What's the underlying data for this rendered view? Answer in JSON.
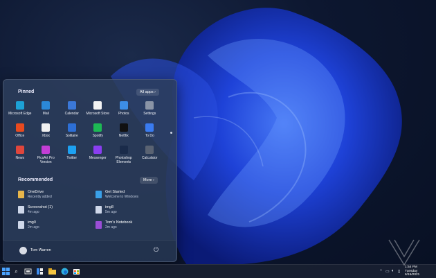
{
  "start_menu": {
    "pinned_title": "Pinned",
    "all_apps_label": "All apps  ›",
    "pinned_apps": [
      {
        "label": "Microsoft Edge",
        "icon": "edge-icon",
        "color": "#1da1d6"
      },
      {
        "label": "Mail",
        "icon": "mail-icon",
        "color": "#2b88d8"
      },
      {
        "label": "Calendar",
        "icon": "calendar-icon",
        "color": "#3b78d8"
      },
      {
        "label": "Microsoft Store",
        "icon": "store-icon",
        "color": "#f3f3f3"
      },
      {
        "label": "Photos",
        "icon": "photos-icon",
        "color": "#3d8ee6"
      },
      {
        "label": "Settings",
        "icon": "settings-icon",
        "color": "#8a94a6"
      },
      {
        "label": "Office",
        "icon": "office-icon",
        "color": "#e84a1f"
      },
      {
        "label": "Xbox",
        "icon": "xbox-icon",
        "color": "#f0f0f0"
      },
      {
        "label": "Solitaire",
        "icon": "solitaire-icon",
        "color": "#2d6fd6"
      },
      {
        "label": "Spotify",
        "icon": "spotify-icon",
        "color": "#1db954"
      },
      {
        "label": "Netflix",
        "icon": "netflix-icon",
        "color": "#111111"
      },
      {
        "label": "To Do",
        "icon": "todo-icon",
        "color": "#3a7bf0"
      },
      {
        "label": "News",
        "icon": "news-icon",
        "color": "#e0463c"
      },
      {
        "label": "PicsArt Pro Version",
        "icon": "picsart-icon",
        "color": "#c33ed6"
      },
      {
        "label": "Twitter",
        "icon": "twitter-icon",
        "color": "#1da1f2"
      },
      {
        "label": "Messenger",
        "icon": "messenger-icon",
        "color": "#8a3ef0"
      },
      {
        "label": "Photoshop Elements",
        "icon": "photoshop-icon",
        "color": "#1a2b4a"
      },
      {
        "label": "Calculator",
        "icon": "calculator-icon",
        "color": "#5a6372"
      }
    ],
    "recommended_title": "Recommended",
    "more_label": "More  ›",
    "recommended": [
      {
        "title": "OneDrive",
        "subtitle": "Recently added",
        "icon": "onedrive-icon",
        "color": "#e8b64a"
      },
      {
        "title": "Get Started",
        "subtitle": "Welcome to Windows",
        "icon": "get-started-icon",
        "color": "#3aa0e8"
      },
      {
        "title": "Screenshot (1)",
        "subtitle": "4m ago",
        "icon": "file-icon",
        "color": "#cfd8ea"
      },
      {
        "title": "img8",
        "subtitle": "5m ago",
        "icon": "file-icon",
        "color": "#cfd8ea"
      },
      {
        "title": "img0",
        "subtitle": "2m ago",
        "icon": "file-icon",
        "color": "#cfd8ea"
      },
      {
        "title": "Tom's Notebook",
        "subtitle": "2m ago",
        "icon": "onenote-icon",
        "color": "#9a4ed6"
      }
    ],
    "user_name": "Tom Warren"
  },
  "taskbar": {
    "clock_time": "1:54 PM",
    "clock_day": "Tuesday",
    "clock_date": "6/15/2021"
  }
}
